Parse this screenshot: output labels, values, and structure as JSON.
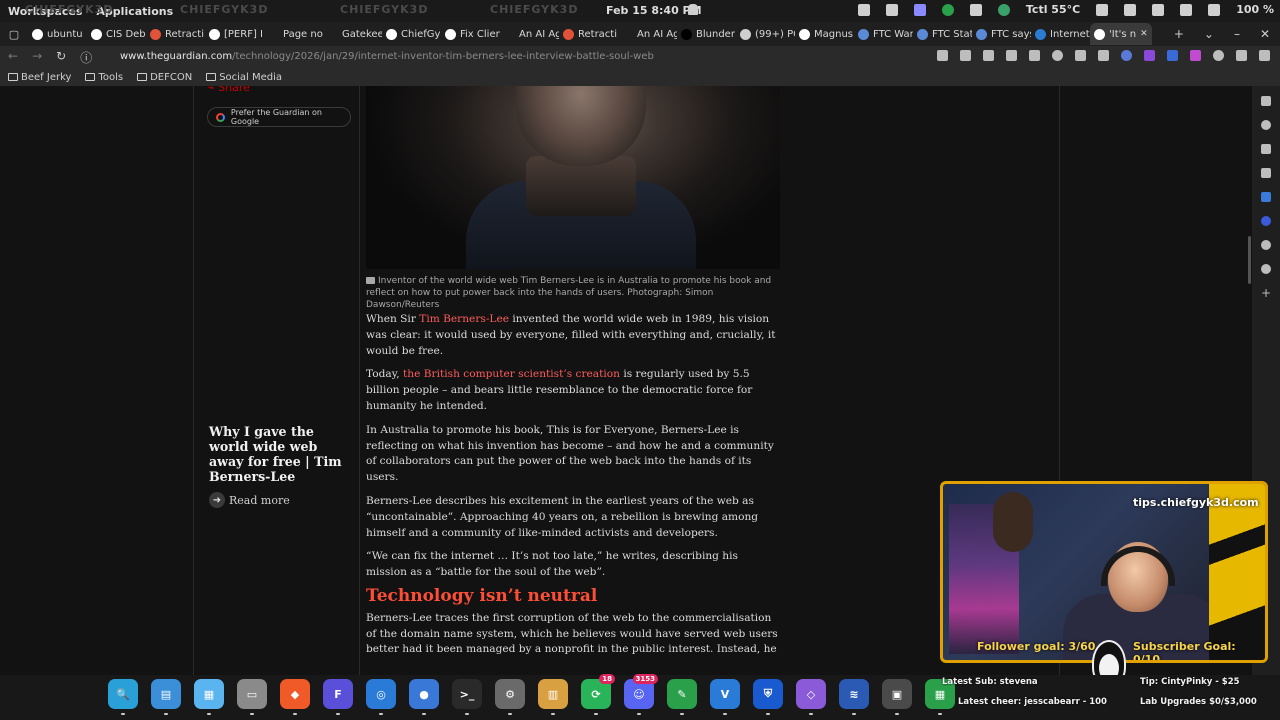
{
  "system_bar": {
    "menu": [
      "Workspaces",
      "Applications"
    ],
    "watermark": "CHIEFGYK3D",
    "clock": "Feb 15  8:40 PM",
    "temperature": "Tctl 55°C",
    "battery": "100 %"
  },
  "tabs": [
    {
      "label": "ubuntu",
      "icon": "github-icon",
      "color": "#ffffff"
    },
    {
      "label": "CIS Deb",
      "icon": "site-icon",
      "color": "#ffffff"
    },
    {
      "label": "Retracti",
      "icon": "retraction-icon",
      "color": "#e0523a"
    },
    {
      "label": "[PERF] I",
      "icon": "github-icon",
      "color": "#ffffff"
    },
    {
      "label": "Page not fo",
      "icon": "blank-icon",
      "color": "#1f1f1f"
    },
    {
      "label": "Gatekeepin",
      "icon": "blank-icon",
      "color": "#1f1f1f"
    },
    {
      "label": "ChiefGy",
      "icon": "github-icon",
      "color": "#ffffff"
    },
    {
      "label": "Fix Clien",
      "icon": "github-icon",
      "color": "#ffffff"
    },
    {
      "label": "An AI Agent",
      "icon": "blank-icon",
      "color": "#1f1f1f"
    },
    {
      "label": "Retracti",
      "icon": "retraction-icon",
      "color": "#e0523a"
    },
    {
      "label": "An AI Agent",
      "icon": "blank-icon",
      "color": "#1f1f1f"
    },
    {
      "label": "Blunder",
      "icon": "blunder-icon",
      "color": "#000000"
    },
    {
      "label": "(99+) PC",
      "icon": "site-icon",
      "color": "#cfcfcf"
    },
    {
      "label": "Magnus",
      "icon": "wikipedia-icon",
      "color": "#ffffff"
    },
    {
      "label": "FTC War",
      "icon": "ftc-icon",
      "color": "#5a8ad6"
    },
    {
      "label": "FTC Stat",
      "icon": "ftc-icon",
      "color": "#5a8ad6"
    },
    {
      "label": "FTC says",
      "icon": "ftc-icon",
      "color": "#5a8ad6"
    },
    {
      "label": "Internet",
      "icon": "dot-icon",
      "color": "#2b7bd1"
    },
    {
      "label": "'It's n",
      "icon": "guardian-icon",
      "color": "#ffffff",
      "active": true
    }
  ],
  "address": {
    "host": "www.theguardian.com",
    "path": "/technology/2026/jan/29/internet-inventor-tim-berners-lee-interview-battle-soul-web"
  },
  "bookmarks": [
    "Beef Jerky",
    "Tools",
    "DEFCON",
    "Social Media"
  ],
  "page": {
    "share_label": "Share",
    "prefer_label": "Prefer the Guardian on Google",
    "caption": "Inventor of the world wide web Tim Berners-Lee is in Australia to promote his book and reflect on how to put power back into the hands of users. Photograph: Simon Dawson/Reuters",
    "p1_a": "When Sir ",
    "p1_link": "Tim Berners-Lee",
    "p1_b": " invented the world wide web in 1989, his vision was clear: it would used by everyone, filled with everything and, crucially, it would be free.",
    "p2_a": "Today, ",
    "p2_link": "the British computer scientist’s creation",
    "p2_b": " is regularly used by 5.5 billion people – and bears little resemblance to the democratic force for humanity he intended.",
    "p3": "In Australia to promote his book, This is for Everyone, Berners-Lee is reflecting on what his invention has become – and how he and a community of collaborators can put the power of the web back into the hands of its users.",
    "p4": "Berners-Lee describes his excitement in the earliest years of the web as “uncontainable”. Approaching 40 years on, a rebellion is brewing among himself and a community of like-minded activists and developers.",
    "p5": "“We can fix the internet … It’s not too late,” he writes, describing his mission as a “battle for the soul of the web”.",
    "heading": "Technology isn’t neutral",
    "p6": "Berners-Lee traces the first corruption of the web to the commercialisation of the domain name system, which he believes would have served web users better had it been managed by a nonprofit in the public interest. Instead, he",
    "related_title": "Why I gave the world wide web away for free | Tim Berners-Lee",
    "read_more": "Read more"
  },
  "overlay": {
    "tip_url": "tips.chiefgyk3d.com",
    "follower_goal": "Follower goal: 3/60",
    "subscriber_goal": "Subscriber Goal: 0/10",
    "latest_sub": "Latest Sub: stevena",
    "latest_cheer": "Latest cheer: jesscabearr - 100",
    "tip": "Tip: CintyPinky - $25",
    "lab": "Lab Upgrades $0/$3,000"
  },
  "dock": [
    {
      "name": "search-app-icon",
      "color": "#2aa0d8",
      "glyph": "🔍"
    },
    {
      "name": "files-app-icon",
      "color": "#3a8fd8",
      "glyph": "▤"
    },
    {
      "name": "app-grid-icon",
      "color": "#5ab4f0",
      "glyph": "▦"
    },
    {
      "name": "folder-app-icon",
      "color": "#8a8a8a",
      "glyph": "▭"
    },
    {
      "name": "brave-browser-icon",
      "color": "#f05a28",
      "glyph": "◆"
    },
    {
      "name": "ferdium-app-icon",
      "color": "#5a4fd8",
      "glyph": "F"
    },
    {
      "name": "network-app-icon",
      "color": "#2a7ad8",
      "glyph": "◎"
    },
    {
      "name": "chrome-browser-icon",
      "color": "#3a78d8",
      "glyph": "●"
    },
    {
      "name": "terminal-app-icon",
      "color": "#2a2a2a",
      "glyph": ">_"
    },
    {
      "name": "settings-app-icon",
      "color": "#6a6a6a",
      "glyph": "⚙"
    },
    {
      "name": "archive-app-icon",
      "color": "#d8a040",
      "glyph": "▥"
    },
    {
      "name": "sync-app-icon",
      "color": "#2ab45a",
      "glyph": "⟳",
      "badge": "18"
    },
    {
      "name": "discord-app-icon",
      "color": "#5865f2",
      "glyph": "☺",
      "badge": "3153"
    },
    {
      "name": "evernote-app-icon",
      "color": "#2aa04a",
      "glyph": "✎"
    },
    {
      "name": "vscode-app-icon",
      "color": "#2a7ad8",
      "glyph": "V"
    },
    {
      "name": "bitwarden-app-icon",
      "color": "#1a5ad0",
      "glyph": "⛨"
    },
    {
      "name": "obsidian-app-icon",
      "color": "#8a5ad8",
      "glyph": "◇"
    },
    {
      "name": "audio-app-icon",
      "color": "#2a5ab4",
      "glyph": "≋"
    },
    {
      "name": "vm-app-icon",
      "color": "#4a4a4a",
      "glyph": "▣"
    },
    {
      "name": "spreadsheet-app-icon",
      "color": "#2aa04a",
      "glyph": "▦"
    }
  ],
  "colors": {
    "link": "#ff5c5c",
    "heading": "#ff4e36",
    "overlay_border": "#e0a100"
  }
}
